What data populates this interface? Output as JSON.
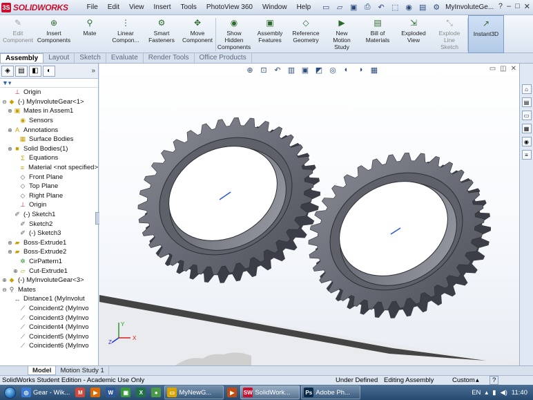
{
  "app": {
    "logo_text": "SOLIDWORKS",
    "document_title": "MyInvoluteGe..."
  },
  "menu": [
    "File",
    "Edit",
    "View",
    "Insert",
    "Tools",
    "PhotoView 360",
    "Window",
    "Help"
  ],
  "quick_access": [
    "new-doc-icon",
    "open-icon",
    "save-icon",
    "print-icon",
    "undo-icon",
    "select-icon",
    "rebuild-icon",
    "file-props-icon",
    "options-icon"
  ],
  "window_controls": {
    "help": "?",
    "minimize": "–",
    "restore": "□",
    "close": "✕"
  },
  "command_manager": [
    {
      "label": "Edit\nComponent",
      "icon": "edit-component-icon",
      "glyph": "✎",
      "dim": true
    },
    {
      "label": "Insert\nComponents",
      "icon": "insert-components-icon",
      "glyph": "⊕",
      "dim": false
    },
    {
      "label": "Mate",
      "icon": "mate-icon",
      "glyph": "⚲",
      "dim": false
    },
    {
      "label": "Linear\nCompon...",
      "icon": "linear-pattern-icon",
      "glyph": "⋮",
      "dim": false
    },
    {
      "label": "Smart\nFasteners",
      "icon": "smart-fasteners-icon",
      "glyph": "⚙",
      "dim": false
    },
    {
      "label": "Move\nComponent",
      "icon": "move-component-icon",
      "glyph": "✥",
      "dim": false
    },
    {
      "label": "Show\nHidden\nComponents",
      "icon": "show-hidden-icon",
      "glyph": "◉",
      "dim": false
    },
    {
      "label": "Assembly\nFeatures",
      "icon": "assembly-features-icon",
      "glyph": "▣",
      "dim": false
    },
    {
      "label": "Reference\nGeometry",
      "icon": "reference-geometry-icon",
      "glyph": "◇",
      "dim": false
    },
    {
      "label": "New\nMotion\nStudy",
      "icon": "motion-study-icon",
      "glyph": "▶",
      "dim": false
    },
    {
      "label": "Bill of\nMaterials",
      "icon": "bom-icon",
      "glyph": "▤",
      "dim": false
    },
    {
      "label": "Exploded\nView",
      "icon": "exploded-view-icon",
      "glyph": "⇲",
      "dim": false
    },
    {
      "label": "Explode\nLine\nSketch",
      "icon": "explode-line-icon",
      "glyph": "⤡",
      "dim": true
    },
    {
      "label": "Instant3D",
      "icon": "instant3d-icon",
      "glyph": "↗",
      "dim": false,
      "active": true
    }
  ],
  "tabs": {
    "items": [
      "Assembly",
      "Layout",
      "Sketch",
      "Evaluate",
      "Render Tools",
      "Office Products"
    ],
    "selected": "Assembly"
  },
  "feature_tree": [
    {
      "label": "Origin",
      "icon": "origin-icon",
      "glyph": "⊥",
      "color": "#b03030",
      "toggle": ""
    },
    {
      "label": "(-) MyInvoluteGear<1>",
      "icon": "part-icon",
      "glyph": "◆",
      "color": "#c9a000",
      "toggle": "⊖"
    },
    {
      "label": "Mates in Assem1",
      "icon": "mates-folder-icon",
      "glyph": "▣",
      "color": "#c9a000",
      "toggle": "⊕"
    },
    {
      "label": "Sensors",
      "icon": "sensors-icon",
      "glyph": "◉",
      "color": "#c9a000",
      "toggle": ""
    },
    {
      "label": "Annotations",
      "icon": "annotations-icon",
      "glyph": "A",
      "color": "#c9a000",
      "toggle": "⊕"
    },
    {
      "label": "Surface Bodies",
      "icon": "surface-bodies-icon",
      "glyph": "▦",
      "color": "#c9a000",
      "toggle": ""
    },
    {
      "label": "Solid Bodies(1)",
      "icon": "solid-bodies-icon",
      "glyph": "■",
      "color": "#c9a000",
      "toggle": "⊕"
    },
    {
      "label": "Equations",
      "icon": "equations-icon",
      "glyph": "Σ",
      "color": "#c9a000",
      "toggle": ""
    },
    {
      "label": "Material <not specified>",
      "icon": "material-icon",
      "glyph": "≡",
      "color": "#c9a000",
      "toggle": ""
    },
    {
      "label": "Front Plane",
      "icon": "plane-icon",
      "glyph": "◇",
      "color": "#555",
      "toggle": ""
    },
    {
      "label": "Top Plane",
      "icon": "plane-icon",
      "glyph": "◇",
      "color": "#555",
      "toggle": ""
    },
    {
      "label": "Right Plane",
      "icon": "plane-icon",
      "glyph": "◇",
      "color": "#555",
      "toggle": ""
    },
    {
      "label": "Origin",
      "icon": "origin-icon",
      "glyph": "⊥",
      "color": "#b03030",
      "toggle": ""
    },
    {
      "label": "(-) Sketch1",
      "icon": "sketch-icon",
      "glyph": "✐",
      "color": "#555",
      "toggle": ""
    },
    {
      "label": "Sketch2",
      "icon": "sketch-icon",
      "glyph": "✐",
      "color": "#555",
      "toggle": ""
    },
    {
      "label": "(-) Sketch3",
      "icon": "sketch-icon",
      "glyph": "✐",
      "color": "#555",
      "toggle": ""
    },
    {
      "label": "Boss-Extrude1",
      "icon": "extrude-icon",
      "glyph": "▰",
      "color": "#c9a000",
      "toggle": "⊕"
    },
    {
      "label": "Boss-Extrude2",
      "icon": "extrude-icon",
      "glyph": "▰",
      "color": "#c9a000",
      "toggle": "⊕"
    },
    {
      "label": "CirPattern1",
      "icon": "circular-pattern-icon",
      "glyph": "✲",
      "color": "#2a8a2a",
      "toggle": ""
    },
    {
      "label": "Cut-Extrude1",
      "icon": "cut-extrude-icon",
      "glyph": "▱",
      "color": "#c9a000",
      "toggle": "⊕"
    },
    {
      "label": "(-) MyInvoluteGear<3>",
      "icon": "part-icon",
      "glyph": "◆",
      "color": "#c9a000",
      "toggle": "⊕"
    },
    {
      "label": "Mates",
      "icon": "mates-icon",
      "glyph": "⚲",
      "color": "#555",
      "toggle": "⊖"
    },
    {
      "label": "Distance1 (MyInvolut",
      "icon": "distance-mate-icon",
      "glyph": "↔",
      "color": "#555",
      "toggle": ""
    },
    {
      "label": "Coincident2 (MyInvo",
      "icon": "coincident-mate-icon",
      "glyph": "⟋",
      "color": "#555",
      "toggle": ""
    },
    {
      "label": "Coincident3 (MyInvo",
      "icon": "coincident-mate-icon",
      "glyph": "⟋",
      "color": "#555",
      "toggle": ""
    },
    {
      "label": "Coincident4 (MyInvo",
      "icon": "coincident-mate-icon",
      "glyph": "⟋",
      "color": "#555",
      "toggle": ""
    },
    {
      "label": "Coincident5 (MyInvo",
      "icon": "coincident-mate-icon",
      "glyph": "⟋",
      "color": "#555",
      "toggle": ""
    },
    {
      "label": "Coincident6 (MyInvo",
      "icon": "coincident-mate-icon",
      "glyph": "⟋",
      "color": "#555",
      "toggle": ""
    }
  ],
  "model_tabs": {
    "items": [
      "Model",
      "Motion Study 1"
    ],
    "selected": "Model"
  },
  "status_bar": {
    "left": "SolidWorks Student Edition - Academic Use Only",
    "state": "Under Defined",
    "mode": "Editing Assembly",
    "units": "Custom",
    "help": "?"
  },
  "triad": {
    "x": "X",
    "y": "Y",
    "z": "Z"
  },
  "taskbar": {
    "apps": [
      {
        "label": "Gear - Wik...",
        "icon": "chrome-icon",
        "bg": "#3a7bd5",
        "glyph": "◎"
      },
      {
        "label": "",
        "icon": "gmail-icon",
        "bg": "#d44638",
        "glyph": "M"
      },
      {
        "label": "",
        "icon": "media-player-icon",
        "bg": "#e06a00",
        "glyph": "▶"
      },
      {
        "label": "",
        "icon": "word-icon",
        "bg": "#2b579a",
        "glyph": "W"
      },
      {
        "label": "",
        "icon": "green-app-icon",
        "bg": "#3a9a3a",
        "glyph": "▣"
      },
      {
        "label": "",
        "icon": "excel-icon",
        "bg": "#1f7244",
        "glyph": "X"
      },
      {
        "label": "",
        "icon": "camtasia-icon",
        "bg": "#4a9a4a",
        "glyph": "●"
      },
      {
        "label": "MyNewG...",
        "icon": "folder-icon",
        "bg": "#d9a400",
        "glyph": "▭",
        "app": true
      },
      {
        "label": "",
        "icon": "presentation-icon",
        "bg": "#c04b10",
        "glyph": "▶"
      },
      {
        "label": "SolidWork...",
        "icon": "solidworks-icon",
        "bg": "#c8102e",
        "glyph": "SW",
        "app": true,
        "active": true
      },
      {
        "label": "Adobe Ph...",
        "icon": "photoshop-icon",
        "bg": "#0b2a4a",
        "glyph": "Ps",
        "app": true
      }
    ],
    "tray": {
      "language": "EN",
      "time": "11:40"
    }
  }
}
